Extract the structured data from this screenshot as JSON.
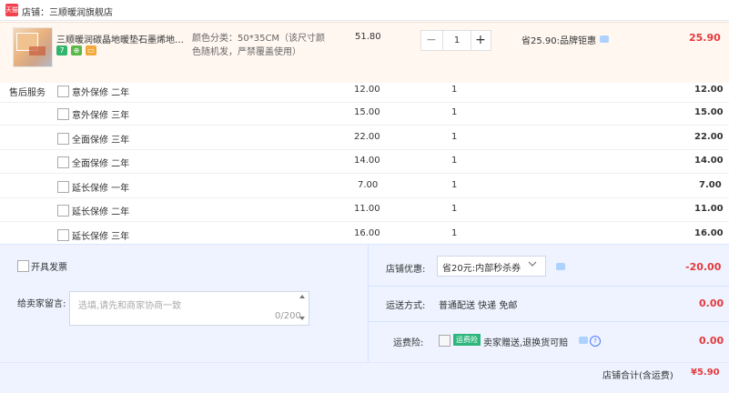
{
  "shop": {
    "badge_label": "天猫",
    "name": "店铺：三顺暖润旗舰店"
  },
  "product": {
    "title": "三顺暖润碳晶地暖垫石墨烯地垫...",
    "badges": [
      "7",
      "⊕",
      "▭"
    ],
    "spec": "颜色分类：50*35CM（该尺寸颜色随机发，严禁覆盖使用）",
    "price": "51.80",
    "qty": "1",
    "saving": "省25.90:品牌钜惠",
    "subtotal": "25.90"
  },
  "services": {
    "label": "售后服务",
    "items": [
      {
        "name": "意外保修 二年",
        "price": "12.00",
        "qty": "1",
        "subtotal": "12.00"
      },
      {
        "name": "意外保修 三年",
        "price": "15.00",
        "qty": "1",
        "subtotal": "15.00"
      },
      {
        "name": "全面保修 三年",
        "price": "22.00",
        "qty": "1",
        "subtotal": "22.00"
      },
      {
        "name": "全面保修 二年",
        "price": "14.00",
        "qty": "1",
        "subtotal": "14.00"
      },
      {
        "name": "延长保修 一年",
        "price": "7.00",
        "qty": "1",
        "subtotal": "7.00"
      },
      {
        "name": "延长保修 二年",
        "price": "11.00",
        "qty": "1",
        "subtotal": "11.00"
      },
      {
        "name": "延长保修 三年",
        "price": "16.00",
        "qty": "1",
        "subtotal": "16.00"
      }
    ]
  },
  "footer": {
    "invoice_label": "开具发票",
    "message_label": "给卖家留言:",
    "message_placeholder": "选填,请先和商家协商一致",
    "message_counter": "0/200",
    "coupon_label": "店铺优惠:",
    "coupon_value": "省20元:内部秒杀券",
    "coupon_amount": "-20.00",
    "shipping_label": "运送方式:",
    "shipping_value": "普通配送 快递 免邮",
    "shipping_amount": "0.00",
    "insurance_label": "运费险:",
    "insurance_badge": "运费险",
    "insurance_text": "卖家赠送,退换货可赔",
    "insurance_amount": "0.00",
    "total_label": "店铺合计(含运费)",
    "total_amount": "¥5.90"
  },
  "colors": {
    "accent_red": "#e4393c",
    "footer_bg": "#eef3ff",
    "product_bg": "#fff7f0",
    "badge_green": "#2db67c"
  },
  "icons": {
    "shop": "tmall-icon",
    "chat": "chat-icon",
    "help": "question-icon",
    "dropdown": "chevron-down-icon"
  }
}
